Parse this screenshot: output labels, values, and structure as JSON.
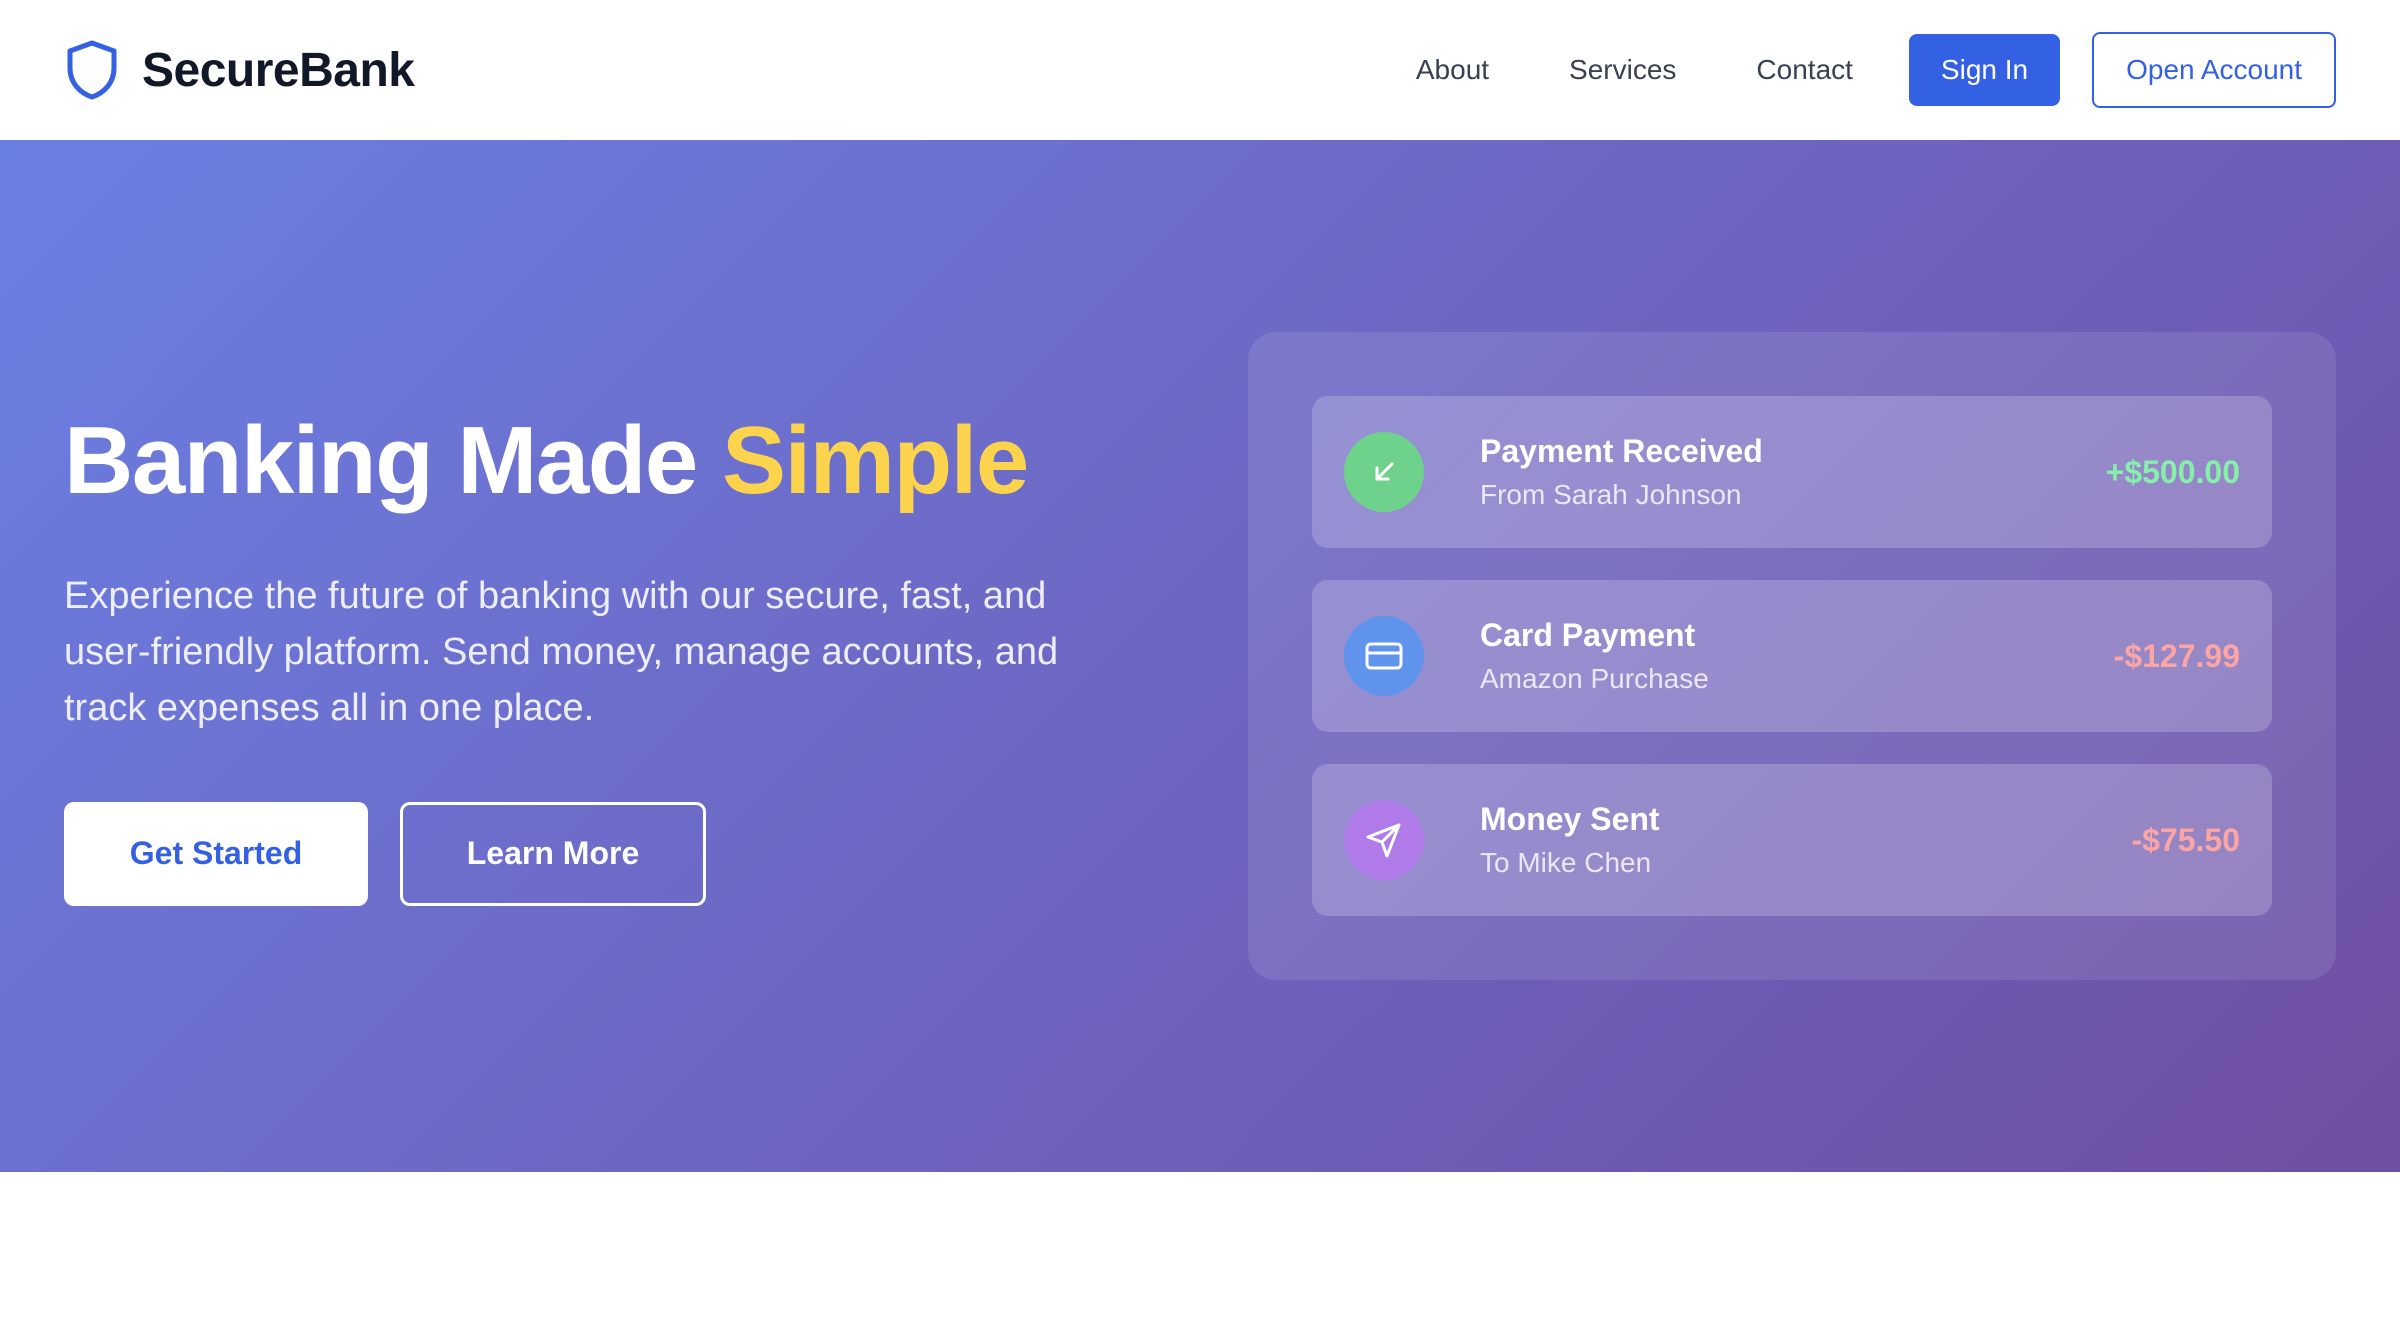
{
  "brand": {
    "name": "SecureBank",
    "logo_icon": "shield-icon",
    "color": "#3461e3"
  },
  "nav": {
    "links": [
      "About",
      "Services",
      "Contact"
    ],
    "sign_in": "Sign In",
    "open_account": "Open Account"
  },
  "hero": {
    "title_main": "Banking Made",
    "title_accent": "Simple",
    "subtitle": "Experience the future of banking with our secure, fast, and user-friendly platform. Send money, manage accounts, and track expenses all in one place.",
    "get_started": "Get Started",
    "learn_more": "Learn More",
    "accent_color": "#fcd34d"
  },
  "transactions": [
    {
      "title": "Payment Received",
      "description": "From Sarah Johnson",
      "amount": "+$500.00",
      "icon": "arrow-down-left-icon",
      "icon_bg": "#6fd28c",
      "amount_color": "#86efac"
    },
    {
      "title": "Card Payment",
      "description": "Amazon Purchase",
      "amount": "-$127.99",
      "icon": "credit-card-icon",
      "icon_bg": "#5f93ec",
      "amount_color": "#fca5a5"
    },
    {
      "title": "Money Sent",
      "description": "To Mike Chen",
      "amount": "-$75.50",
      "icon": "send-icon",
      "icon_bg": "#b07ae8",
      "amount_color": "#fca5a5"
    }
  ]
}
